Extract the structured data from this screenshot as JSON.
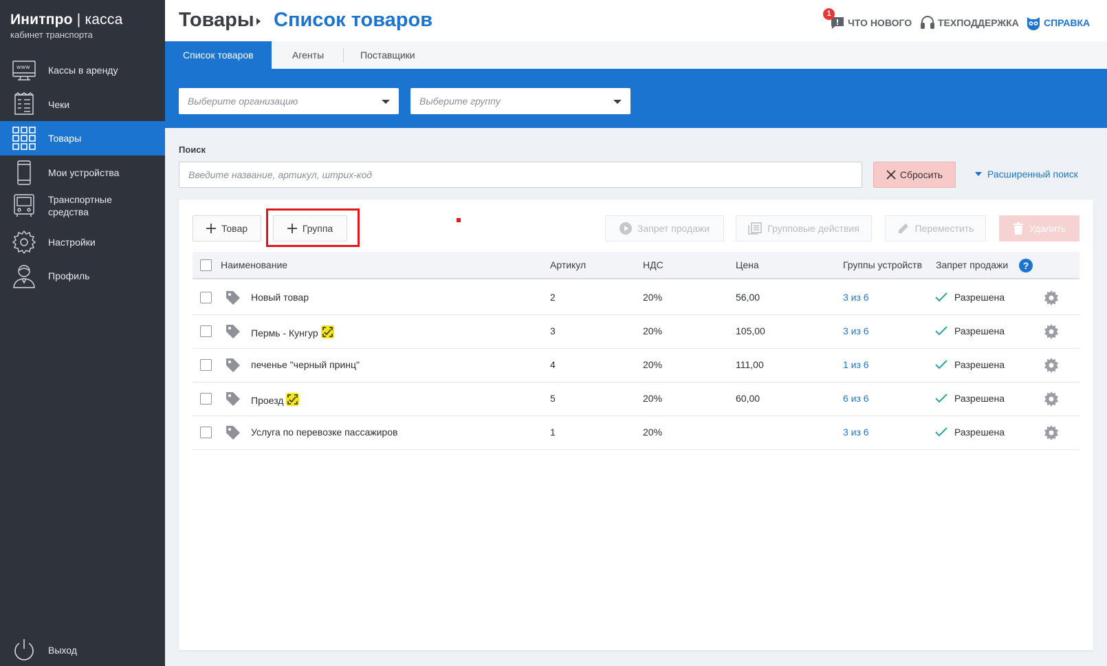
{
  "brand": {
    "name_bold": "Инитпро",
    "name_rest": " | касса",
    "subtitle": "кабинет транспорта"
  },
  "sidebar": {
    "items": [
      {
        "label": "Кассы в аренду",
        "icon": "www-monitor-icon"
      },
      {
        "label": "Чеки",
        "icon": "receipt-icon"
      },
      {
        "label": "Товары",
        "icon": "grid-icon",
        "active": true
      },
      {
        "label": "Мои устройства",
        "icon": "phone-icon"
      },
      {
        "label": "Транспортные средства",
        "icon": "bus-icon"
      },
      {
        "label": "Настройки",
        "icon": "gear-icon"
      },
      {
        "label": "Профиль",
        "icon": "user-icon"
      }
    ],
    "logout": "Выход"
  },
  "header": {
    "breadcrumb_root": "Товары",
    "breadcrumb_current": "Список товаров",
    "whats_new": "ЧТО НОВОГО",
    "whats_new_badge": "1",
    "support": "ТЕХПОДДЕРЖКА",
    "help": "СПРАВКА"
  },
  "tabs": [
    "Список товаров",
    "Агенты",
    "Поставщики"
  ],
  "filters": {
    "organization_placeholder": "Выберите организацию",
    "group_placeholder": "Выберите группу"
  },
  "search": {
    "label": "Поиск",
    "placeholder": "Введите название, артикул, штрих-код",
    "value": "",
    "reset": "Сбросить",
    "advanced": "Расширенный поиск"
  },
  "toolbar": {
    "add_product": "Товар",
    "add_group": "Группа",
    "ban_sale": "Запрет продажи",
    "group_actions": "Групповые действия",
    "move": "Переместить",
    "delete": "Удалить"
  },
  "table": {
    "columns": [
      "Наименование",
      "Артикул",
      "НДС",
      "Цена",
      "Группы устройств",
      "Запрет продажи"
    ],
    "rows": [
      {
        "name": "Новый товар",
        "article": "2",
        "vat": "20%",
        "price": "56,00",
        "groups": "3 из 6",
        "status": "Разрешена",
        "qr": false
      },
      {
        "name": "Пермь - Кунгур",
        "article": "3",
        "vat": "20%",
        "price": "105,00",
        "groups": "3 из 6",
        "status": "Разрешена",
        "qr": true
      },
      {
        "name": "печенье \"черный принц\"",
        "article": "4",
        "vat": "20%",
        "price": "111,00",
        "groups": "1 из 6",
        "status": "Разрешена",
        "qr": false
      },
      {
        "name": "Проезд",
        "article": "5",
        "vat": "20%",
        "price": "60,00",
        "groups": "6 из 6",
        "status": "Разрешена",
        "qr": true
      },
      {
        "name": "Услуга по перевозке пассажиров",
        "article": "1",
        "vat": "20%",
        "price": "",
        "groups": "3 из 6",
        "status": "Разрешена",
        "qr": false
      }
    ]
  },
  "colors": {
    "primary": "#1b75d0",
    "sidebar": "#2f333c",
    "success": "#26a69a",
    "highlight": "#e0161b"
  }
}
